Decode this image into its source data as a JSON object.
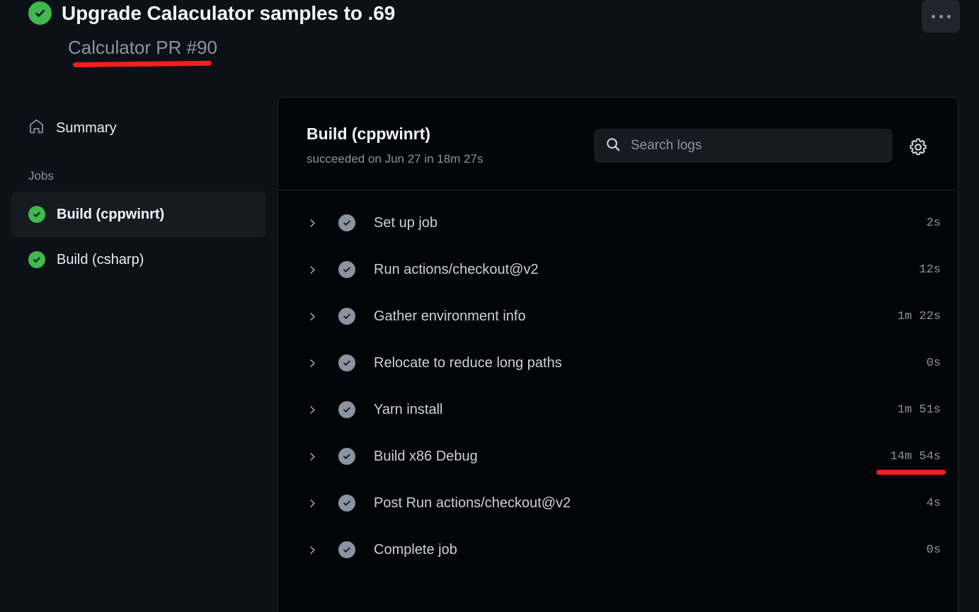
{
  "header": {
    "status_icon": "check-circle-icon",
    "title": "Upgrade Calaculator samples to .69",
    "subtitle": "Calculator PR #90",
    "menu_button_label": "···",
    "menu_icon": "kebab-menu-icon"
  },
  "sidebar": {
    "summary": {
      "icon": "home-icon",
      "label": "Summary"
    },
    "jobs_heading": "Jobs",
    "jobs": [
      {
        "label": "Build (cppwinrt)",
        "status": "success",
        "selected": true
      },
      {
        "label": "Build (csharp)",
        "status": "success",
        "selected": false
      }
    ]
  },
  "panel": {
    "title": "Build (cppwinrt)",
    "subtitle": "succeeded on Jun 27 in 18m 27s",
    "search": {
      "icon": "search-icon",
      "value": "",
      "placeholder": "Search logs"
    },
    "settings_icon": "gear-icon",
    "steps": [
      {
        "label": "Set up job",
        "duration": "2s",
        "status": "success",
        "expand_icon": "chevron-right-icon"
      },
      {
        "label": "Run actions/checkout@v2",
        "duration": "12s",
        "status": "success",
        "expand_icon": "chevron-right-icon"
      },
      {
        "label": "Gather environment info",
        "duration": "1m 22s",
        "status": "success",
        "expand_icon": "chevron-right-icon"
      },
      {
        "label": "Relocate to reduce long paths",
        "duration": "0s",
        "status": "success",
        "expand_icon": "chevron-right-icon"
      },
      {
        "label": "Yarn install",
        "duration": "1m 51s",
        "status": "success",
        "expand_icon": "chevron-right-icon"
      },
      {
        "label": "Build x86 Debug",
        "duration": "14m 54s",
        "status": "success",
        "expand_icon": "chevron-right-icon",
        "annotated": true
      },
      {
        "label": "Post Run actions/checkout@v2",
        "duration": "4s",
        "status": "success",
        "expand_icon": "chevron-right-icon"
      },
      {
        "label": "Complete job",
        "duration": "0s",
        "status": "success",
        "expand_icon": "chevron-right-icon"
      }
    ]
  },
  "annotations": {
    "color": "#f61d1d",
    "marks": [
      "subtitle-underline",
      "build-x86-debug-duration-underline"
    ]
  },
  "colors": {
    "page_background": "#0d1117",
    "panel_background": "#010409",
    "success_green": "#3fb950",
    "muted_text": "#8b949e",
    "primary_text": "#f0f6fc",
    "annotation_red": "#f61d1d"
  }
}
